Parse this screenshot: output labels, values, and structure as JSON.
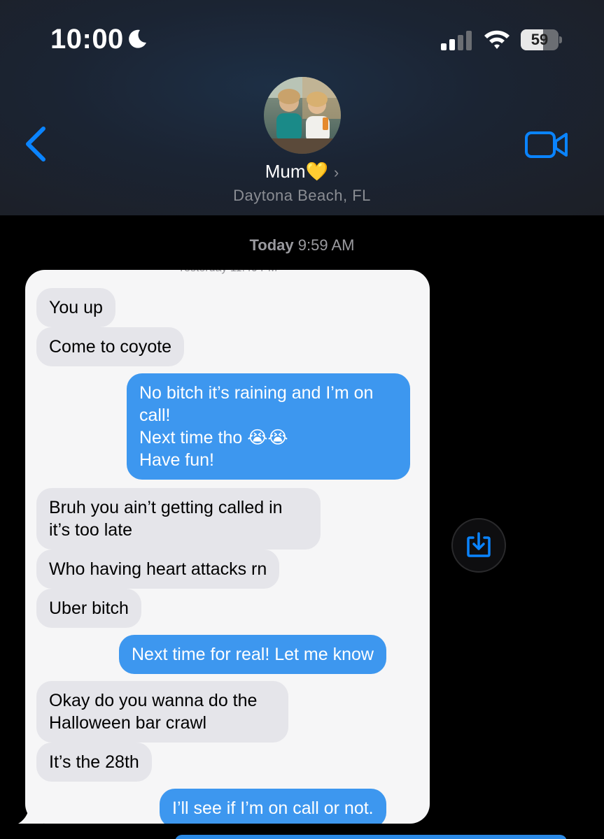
{
  "status_bar": {
    "time": "10:00",
    "battery": "59",
    "battery_level": 0.59,
    "icons": [
      "moon-icon",
      "signal-icon",
      "wifi-icon",
      "battery-icon"
    ]
  },
  "header": {
    "contact_name": "Mum",
    "contact_emoji": "💛",
    "chevron": "›",
    "location": "Daytona Beach, FL",
    "icons": [
      "back-chevron-icon",
      "video-call-icon"
    ]
  },
  "thread": {
    "timestamp_day": "Today",
    "timestamp_time": "9:59 AM"
  },
  "screenshot_card": {
    "messages": [
      {
        "from": "them",
        "text": "You up"
      },
      {
        "from": "them",
        "text": "Come to coyote"
      },
      {
        "from": "me",
        "text": "No bitch it’s raining and I’m on\ncall!\nNext time tho 😭😭\nHave fun!"
      },
      {
        "from": "them",
        "text": "Bruh you ain’t getting called in\nit’s too late"
      },
      {
        "from": "them",
        "text": "Who having heart attacks rn"
      },
      {
        "from": "them",
        "text": "Uber bitch"
      },
      {
        "from": "me",
        "text": "Next time for real! Let me know"
      },
      {
        "from": "them",
        "text": "Okay do you wanna do the\nHalloween bar crawl"
      },
      {
        "from": "them",
        "text": "It’s the 28th"
      },
      {
        "from": "me",
        "text": "I’ll see if I’m on call or not."
      }
    ]
  },
  "colors": {
    "ios_blue": "#0a84ff",
    "outgoing_bubble": "#3d97ef",
    "incoming_bubble": "#e5e5ea",
    "heart": "#f4c430"
  }
}
